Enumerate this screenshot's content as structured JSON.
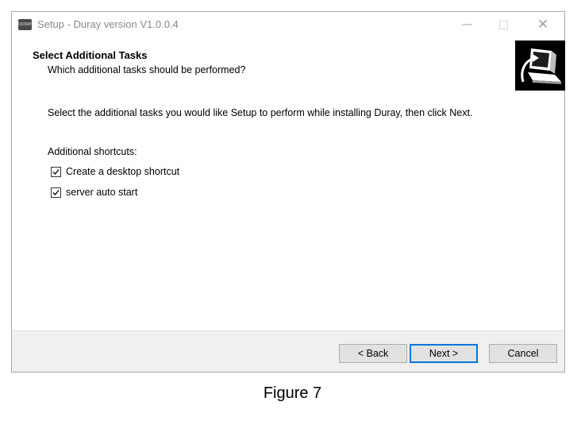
{
  "window": {
    "icon_text": "DURAY",
    "title": "Setup - Duray version V1.0.0.4",
    "minimize_glyph": "—",
    "close_glyph": "✕"
  },
  "header": {
    "title": "Select Additional Tasks",
    "subtitle": "Which additional tasks should be performed?",
    "image_icon": "computer-install-icon"
  },
  "body": {
    "instruction": "Select the additional tasks you would like Setup to perform while installing Duray, then click Next.",
    "group_label": "Additional shortcuts:",
    "tasks": [
      {
        "label": "Create a desktop shortcut",
        "checked": true
      },
      {
        "label": "server auto start",
        "checked": true
      }
    ]
  },
  "footer": {
    "back_label": "< Back",
    "next_label": "Next >",
    "cancel_label": "Cancel"
  },
  "caption": "Figure 7",
  "colors": {
    "accent": "#0078d7",
    "footer_bg": "#f0f0f0"
  }
}
